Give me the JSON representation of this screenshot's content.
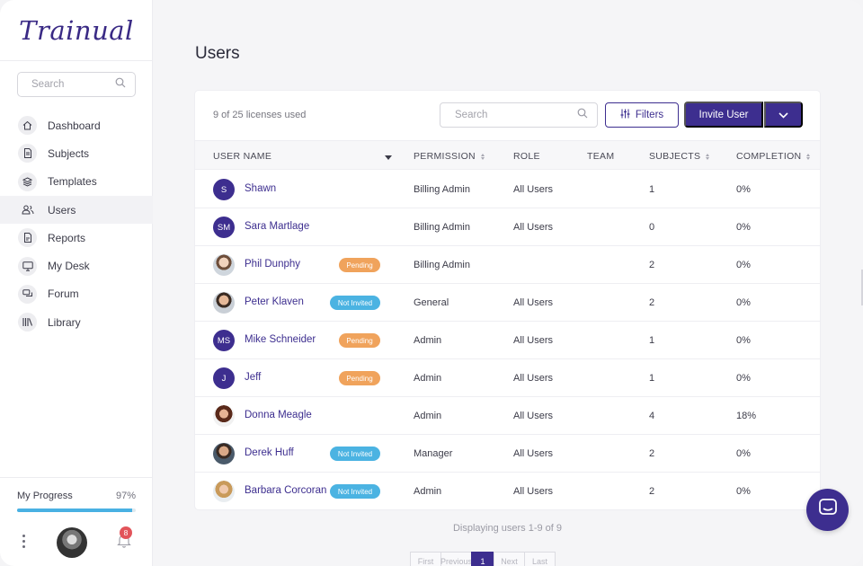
{
  "app": {
    "logo": "Trainual"
  },
  "sidebar": {
    "search_placeholder": "Search",
    "items": [
      {
        "label": "Dashboard",
        "icon": "home-icon"
      },
      {
        "label": "Subjects",
        "icon": "document-icon"
      },
      {
        "label": "Templates",
        "icon": "layers-icon"
      },
      {
        "label": "Users",
        "icon": "users-icon",
        "active": true
      },
      {
        "label": "Reports",
        "icon": "report-icon"
      },
      {
        "label": "My Desk",
        "icon": "monitor-icon"
      },
      {
        "label": "Forum",
        "icon": "chat-bubbles-icon"
      },
      {
        "label": "Library",
        "icon": "library-icon"
      }
    ],
    "progress": {
      "label": "My Progress",
      "value_text": "97%",
      "fraction": 0.97
    },
    "notifications_count": "8"
  },
  "main": {
    "title": "Users",
    "licenses": "9 of 25 licenses used",
    "search_placeholder": "Search",
    "filters_label": "Filters",
    "invite_label": "Invite User",
    "columns": [
      "USER NAME",
      "PERMISSION",
      "ROLE",
      "TEAM",
      "SUBJECTS",
      "COMPLETION"
    ],
    "rows": [
      {
        "initials": "S",
        "name": "Shawn",
        "status": "",
        "permission": "Billing Admin",
        "role": "All Users",
        "team": "",
        "subjects": "1",
        "completion": "0%"
      },
      {
        "initials": "SM",
        "name": "Sara Martlage",
        "status": "",
        "permission": "Billing Admin",
        "role": "All Users",
        "team": "",
        "subjects": "0",
        "completion": "0%"
      },
      {
        "initials": "",
        "name": "Phil Dunphy",
        "status": "Pending",
        "permission": "Billing Admin",
        "role": "",
        "team": "",
        "subjects": "2",
        "completion": "0%"
      },
      {
        "initials": "",
        "name": "Peter Klaven",
        "status": "Not Invited",
        "permission": "General",
        "role": "All Users",
        "team": "",
        "subjects": "2",
        "completion": "0%"
      },
      {
        "initials": "MS",
        "name": "Mike Schneider",
        "status": "Pending",
        "permission": "Admin",
        "role": "All Users",
        "team": "",
        "subjects": "1",
        "completion": "0%"
      },
      {
        "initials": "J",
        "name": "Jeff",
        "status": "Pending",
        "permission": "Admin",
        "role": "All Users",
        "team": "",
        "subjects": "1",
        "completion": "0%"
      },
      {
        "initials": "",
        "name": "Donna Meagle",
        "status": "",
        "permission": "Admin",
        "role": "All Users",
        "team": "",
        "subjects": "4",
        "completion": "18%"
      },
      {
        "initials": "",
        "name": "Derek Huff",
        "status": "Not Invited",
        "permission": "Manager",
        "role": "All Users",
        "team": "",
        "subjects": "2",
        "completion": "0%"
      },
      {
        "initials": "",
        "name": "Barbara Corcoran",
        "status": "Not Invited",
        "permission": "Admin",
        "role": "All Users",
        "team": "",
        "subjects": "2",
        "completion": "0%"
      }
    ],
    "footer": "Displaying users 1-9 of 9",
    "pagination": [
      "First",
      "Previous",
      "1",
      "Next",
      "Last"
    ]
  },
  "colors": {
    "brand": "#3d2e8f",
    "pending": "#f0a35c",
    "not_invited": "#4bb3e2",
    "progress": "#49b1e3"
  }
}
